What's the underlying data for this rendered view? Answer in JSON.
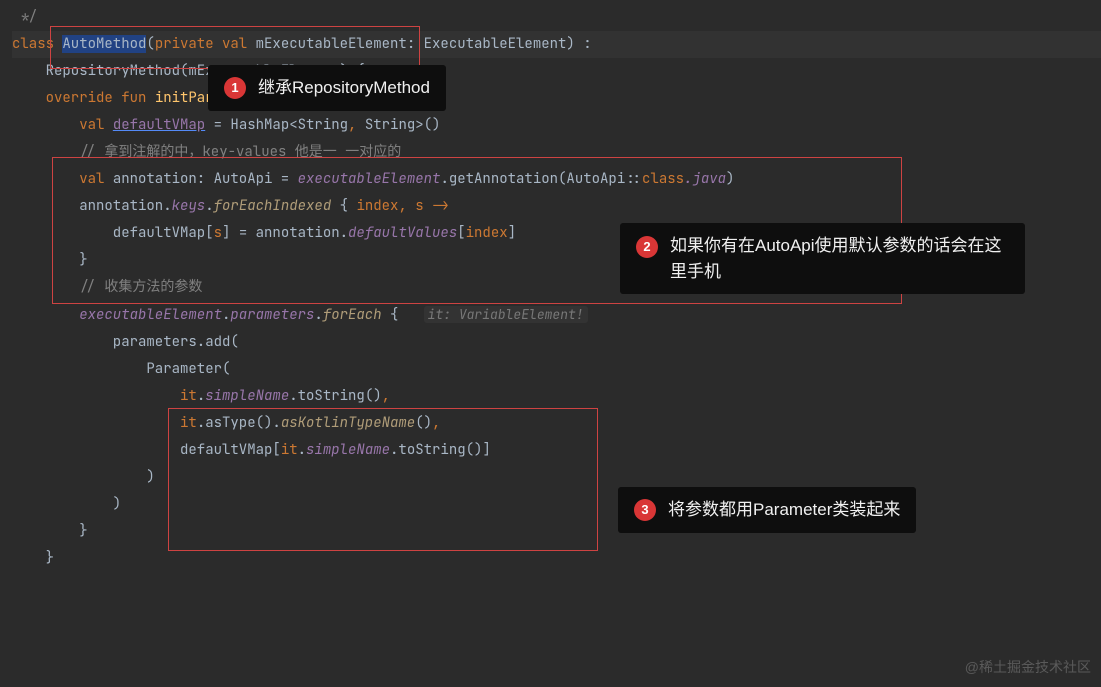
{
  "code": {
    "l0": " */",
    "l1a": "class ",
    "l1b": "AutoMethod",
    "l1c": "(",
    "l1d": "private val ",
    "l1e": "mExecutableElement: ExecutableElement) :",
    "l2a": "    RepositoryMethod(mExecutableElement) {",
    "l3": "",
    "l4a": "    override fun ",
    "l4b": "initParameters",
    "l4c": "() {",
    "l5a": "        val ",
    "l5b": "defaultVMap",
    "l5c": " = HashMap<String",
    "l5d": ", ",
    "l5e": "String>()",
    "l6a": "        // 拿到注解的中，key-values 他是一 一对应的",
    "l7a": "        val ",
    "l7b": "annotation: AutoApi = ",
    "l7c": "executableElement",
    "l7d": ".getAnnotation(AutoApi::",
    "l7e": "class",
    "l7f": ".java",
    "l7g": ")",
    "l8a": "        annotation.",
    "l8b": "keys",
    "l8c": ".",
    "l8d": "forEachIndexed",
    "l8e": " { ",
    "l8f": "index",
    "l8g": ", ",
    "l8h": "s ->",
    "l9a": "            defaultVMap[",
    "l9b": "s",
    "l9c": "] = annotation.",
    "l9d": "defaultValues",
    "l9e": "[",
    "l9f": "index",
    "l9g": "]",
    "l10": "        }",
    "l11": "",
    "l12": "        // 收集方法的参数",
    "l13a": "        executableElement",
    "l13b": ".",
    "l13c": "parameters",
    "l13d": ".",
    "l13e": "forEach",
    "l13f": " {   ",
    "l13hint": "it: VariableElement!",
    "l14a": "            parameters.add(",
    "l15a": "                Parameter(",
    "l16a": "                    ",
    "l16b": "it",
    "l16c": ".",
    "l16d": "simpleName",
    "l16e": ".toString()",
    "l16f": ",",
    "l17a": "                    ",
    "l17b": "it",
    "l17c": ".asType().",
    "l17d": "asKotlinTypeName",
    "l17e": "()",
    "l17f": ",",
    "l18a": "                    defaultVMap[",
    "l18b": "it",
    "l18c": ".",
    "l18d": "simpleName",
    "l18e": ".toString()]",
    "l19": "                )",
    "l20": "            )",
    "l21": "        }",
    "l22": "",
    "l23": "    }"
  },
  "annotations": {
    "badge1": "1",
    "text1": "继承RepositoryMethod",
    "badge2": "2",
    "text2": "如果你有在AutoApi使用默认参数的话会在这里手机",
    "badge3": "3",
    "text3": "将参数都用Parameter类装起来"
  },
  "watermark": "@稀土掘金技术社区"
}
